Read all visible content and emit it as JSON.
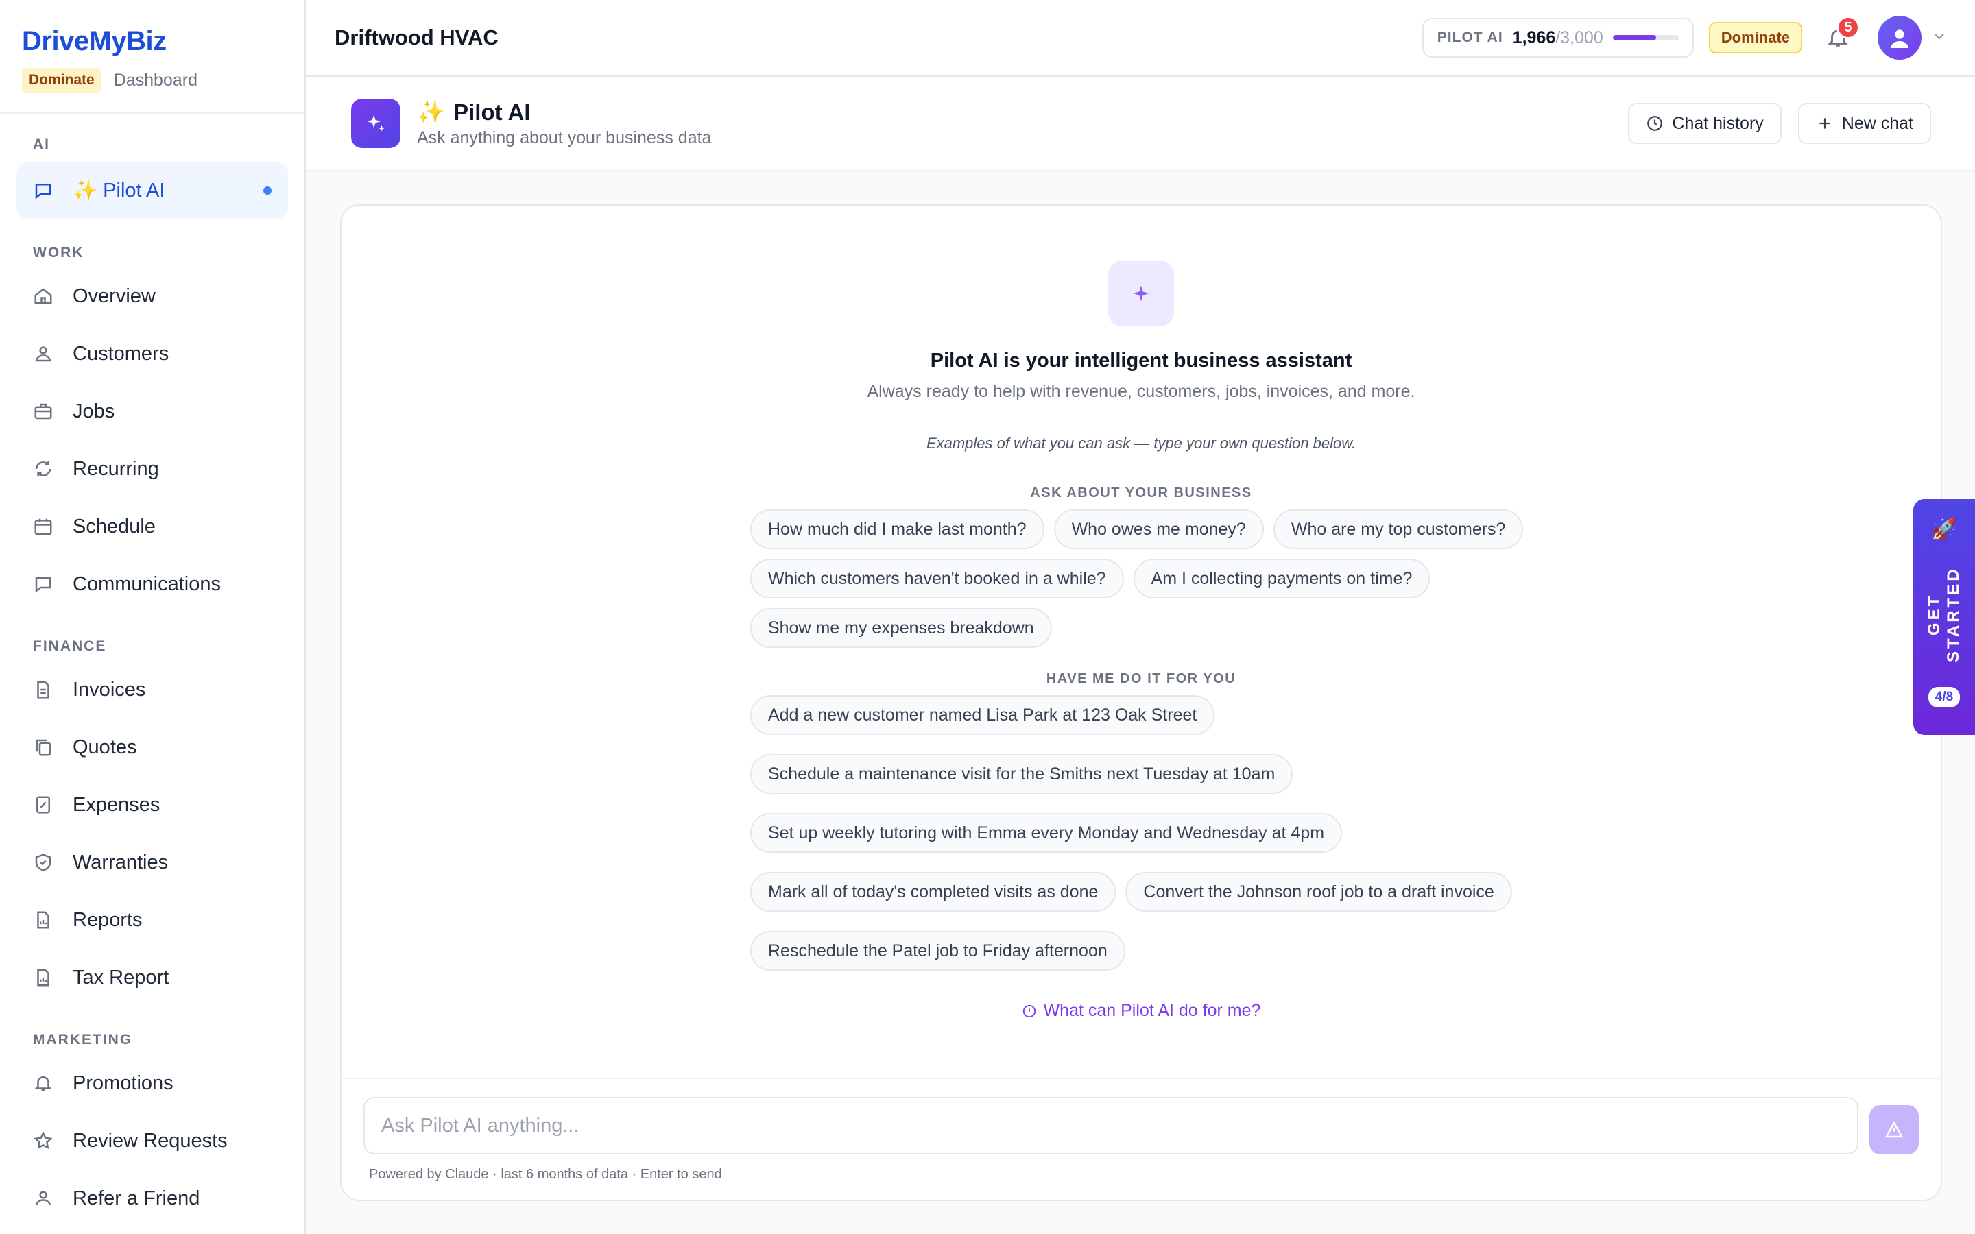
{
  "brand": {
    "name": "DriveMyBiz",
    "plan_badge": "Dominate",
    "breadcrumb": "Dashboard"
  },
  "sidebar": {
    "sections": {
      "ai": "AI",
      "work": "WORK",
      "finance": "FINANCE",
      "marketing": "MARKETING"
    },
    "ai_item": {
      "emoji": "✨",
      "label": "Pilot AI"
    },
    "work_items": [
      "Overview",
      "Customers",
      "Jobs",
      "Recurring",
      "Schedule",
      "Communications"
    ],
    "finance_items": [
      "Invoices",
      "Quotes",
      "Expenses",
      "Warranties",
      "Reports",
      "Tax Report"
    ],
    "marketing_items": [
      "Promotions",
      "Review Requests",
      "Refer a Friend"
    ]
  },
  "topbar": {
    "business_name": "Driftwood HVAC",
    "usage": {
      "label": "PILOT AI",
      "used": "1,966",
      "max": "/3,000",
      "fraction": 0.655
    },
    "plan_chip": "Dominate",
    "notifications_count": "5"
  },
  "page": {
    "emoji": "✨",
    "title": "Pilot AI",
    "subtitle": "Ask anything about your business data",
    "chat_history_label": "Chat history",
    "new_chat_label": "New chat"
  },
  "chat": {
    "hero_title": "Pilot AI is your intelligent business assistant",
    "hero_subtitle": "Always ready to help with revenue, customers, jobs, invoices, and more.",
    "examples_note": "Examples of what you can ask — type your own question below.",
    "ask_label": "ASK ABOUT YOUR BUSINESS",
    "ask_chips": [
      "How much did I make last month?",
      "Who owes me money?",
      "Who are my top customers?",
      "Which customers haven't booked in a while?",
      "Am I collecting payments on time?",
      "Show me my expenses breakdown"
    ],
    "do_label": "HAVE ME DO IT FOR YOU",
    "do_chips": [
      "Add a new customer named Lisa Park at 123 Oak Street",
      "Schedule a maintenance visit for the Smiths next Tuesday at 10am",
      "Set up weekly tutoring with Emma every Monday and Wednesday at 4pm",
      "Mark all of today's completed visits as done",
      "Convert the Johnson roof job to a draft invoice",
      "Reschedule the Patel job to Friday afternoon"
    ],
    "help_link": "What can Pilot AI do for me?",
    "input_placeholder": "Ask Pilot AI anything...",
    "input_footer": "Powered by Claude · last 6 months of data · Enter to send"
  },
  "get_started": {
    "label": "GET STARTED",
    "step": "4/8",
    "icon": "🚀"
  },
  "colors": {
    "accent": "#7c3aed",
    "brand": "#1d4ed8",
    "active_bg": "#eff6ff"
  }
}
